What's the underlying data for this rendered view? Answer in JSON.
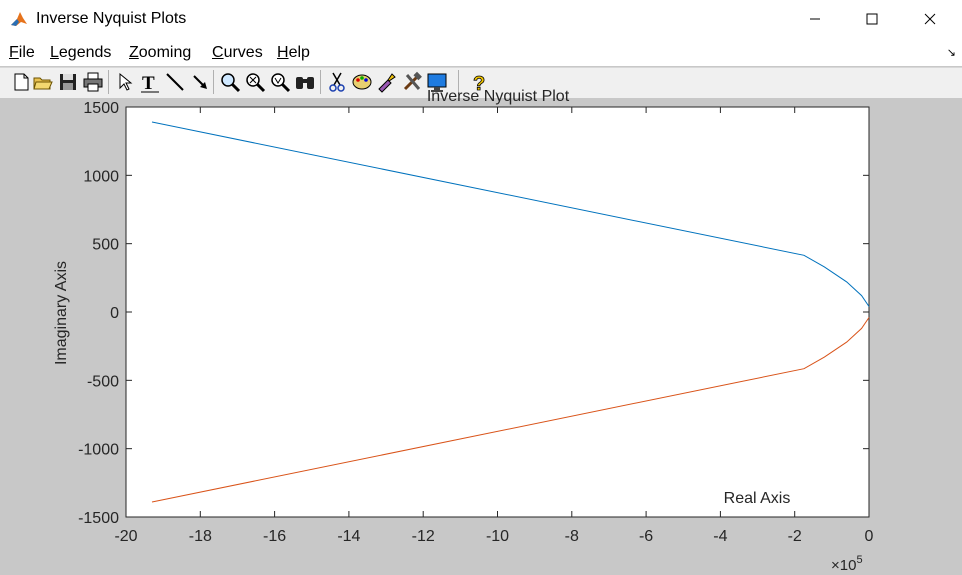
{
  "window": {
    "title": "Inverse Nyquist Plots"
  },
  "menu": [
    {
      "key": "F",
      "rest": "ile"
    },
    {
      "key": "L",
      "rest": "egends"
    },
    {
      "key": "Z",
      "rest": "ooming"
    },
    {
      "key": "C",
      "rest": "urves"
    },
    {
      "key": "H",
      "rest": "elp"
    }
  ],
  "toolbar": [
    "new-icon",
    "open-icon",
    "save-icon",
    "print-icon",
    "pointer-icon",
    "text-icon",
    "line-icon",
    "arrow-icon",
    "zoom-in-icon",
    "zoom-out-icon",
    "zoom-fit-icon",
    "find-icon",
    "cut-icon",
    "palette-icon",
    "paint-icon",
    "tools-icon",
    "monitor-icon",
    "help-icon"
  ],
  "chart_data": {
    "type": "line",
    "title": "Inverse Nyquist Plot",
    "xlabel": "Real Axis",
    "ylabel": "Imaginary Axis",
    "x_multiplier": "×10^5",
    "xlim": [
      -20,
      0
    ],
    "ylim": [
      -1500,
      1500
    ],
    "xticks": [
      -20,
      -18,
      -16,
      -14,
      -12,
      -10,
      -8,
      -6,
      -4,
      -2,
      0
    ],
    "yticks": [
      -1500,
      -1000,
      -500,
      0,
      500,
      1000,
      1500
    ],
    "series": [
      {
        "color": "#0072BD",
        "x": [
          -19.3,
          -1.75,
          -1.2,
          -0.6,
          -0.2,
          0.0
        ],
        "y": [
          1390,
          415,
          330,
          220,
          120,
          40
        ]
      },
      {
        "color": "#D95319",
        "x": [
          -19.3,
          -1.75,
          -1.2,
          -0.6,
          -0.2,
          0.0
        ],
        "y": [
          -1390,
          -415,
          -330,
          -220,
          -120,
          -40
        ]
      }
    ]
  }
}
